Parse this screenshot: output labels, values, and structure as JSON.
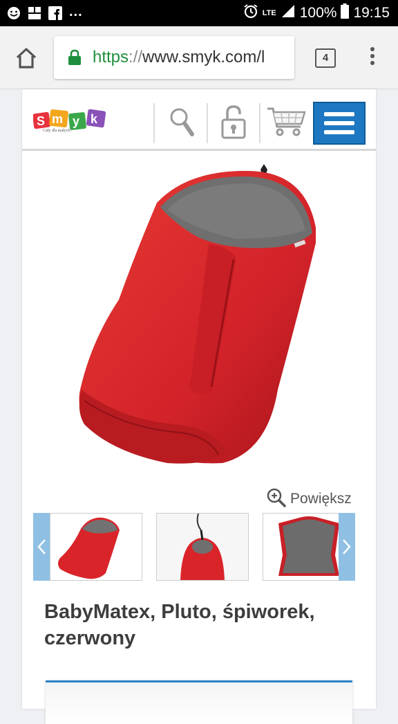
{
  "status_bar": {
    "dots": "...",
    "network": "LTE",
    "battery": "100%",
    "time": "19:15"
  },
  "browser": {
    "url_scheme": "https",
    "url_sep": "://",
    "url_host": "www.smyk.com/l",
    "tab_count": "4"
  },
  "site": {
    "logo_tagline": "Cały dla małych!"
  },
  "product": {
    "zoom_label": "Powiększ",
    "title": "BabyMatex, Pluto, śpiworek, czerwony"
  },
  "colors": {
    "accent": "#1d78c1",
    "product_red": "#d9252a",
    "lock_green": "#1e8e3e"
  }
}
